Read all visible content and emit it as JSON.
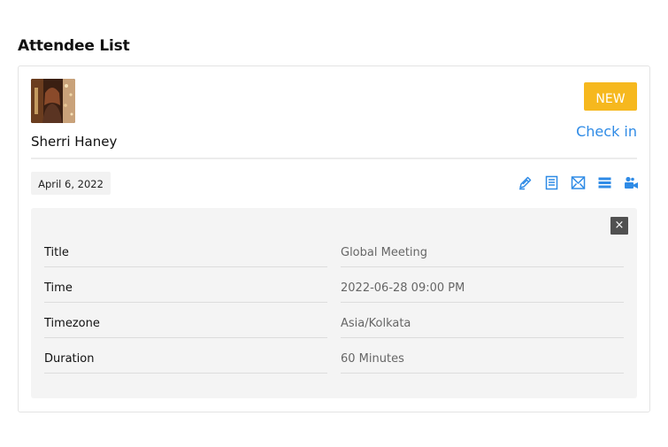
{
  "page": {
    "title": "Attendee List"
  },
  "attendee": {
    "name": "Sherri Haney",
    "badge": "NEW",
    "check_in_label": "Check in",
    "date": "April 6, 2022",
    "avatar": "photo-avatar"
  },
  "actions": [
    {
      "icon": "edit-icon"
    },
    {
      "icon": "document-icon"
    },
    {
      "icon": "email-icon"
    },
    {
      "icon": "list-icon"
    },
    {
      "icon": "video-call-icon"
    }
  ],
  "details": {
    "close_label": "×",
    "rows": [
      {
        "label": "Title",
        "value": "Global Meeting"
      },
      {
        "label": "Time",
        "value": "2022-06-28 09:00 PM"
      },
      {
        "label": "Timezone",
        "value": "Asia/Kolkata"
      },
      {
        "label": "Duration",
        "value": "60 Minutes"
      }
    ]
  },
  "colors": {
    "accent": "#2f8be6",
    "badge": "#f6b81e",
    "close_button": "#505050",
    "details_bg": "#f4f4f4"
  }
}
